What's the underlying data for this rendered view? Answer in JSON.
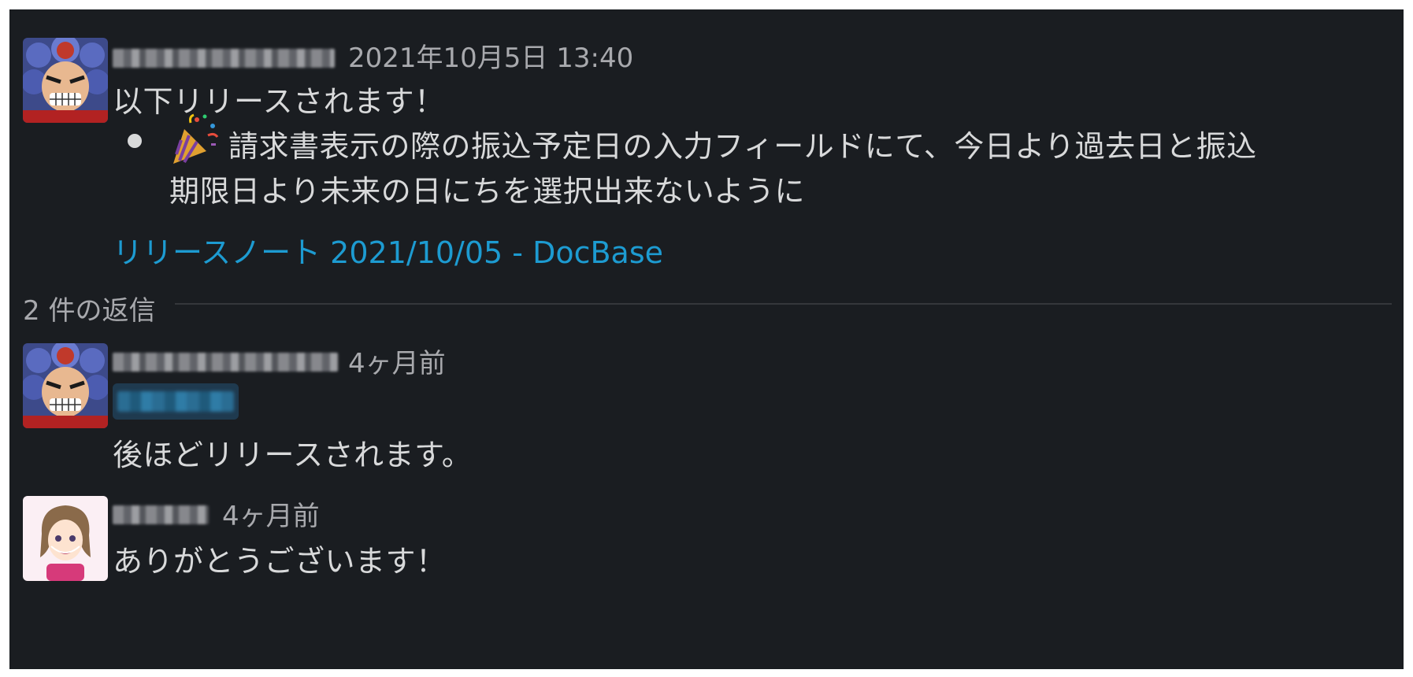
{
  "thread": {
    "parent": {
      "timestamp": "2021年10月5日 13:40",
      "headline": "以下リリースされます！",
      "bullet_line1": "請求書表示の際の振込予定日の入力フィールドにて、今日より過去日と振込",
      "bullet_line2": "期限日より未来の日にちを選択出来ないように",
      "bullet_emoji": "party-popper",
      "link_text": "リリースノート 2021/10/05 - DocBase"
    },
    "replies_label": "2 件の返信",
    "replies": [
      {
        "timestamp": "4ヶ月前",
        "text": "後ほどリリースされます。"
      },
      {
        "timestamp": "4ヶ月前",
        "text": "ありがとうございます！"
      }
    ]
  },
  "colors": {
    "background": "#1a1d21",
    "text": "#d8d9da",
    "muted": "#a8a9ad",
    "link": "#1d9bd1"
  }
}
